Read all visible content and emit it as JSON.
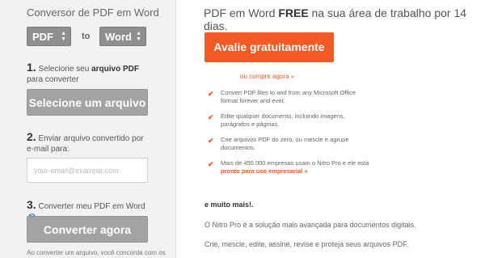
{
  "converter": {
    "title": "Conversor de PDF em Word",
    "from_value": "PDF",
    "to_label": "to",
    "to_value": "Word",
    "step1": {
      "num": "1.",
      "text_a": " Selecione seu ",
      "text_b": "arquivo PDF",
      "text_c": " para converter"
    },
    "select_button": "Selecione um arquivo",
    "step2": {
      "num": "2.",
      "text": " Enviar arquivo convertido por e-mail para:"
    },
    "email_placeholder": "your-email@example.com",
    "step3": {
      "num": "3.",
      "text": " Converter meu PDF em Word",
      "help_icon": "?"
    },
    "convert_button": "Converter agora",
    "footnote": "Ao converter um arquivo, você concorda com os"
  },
  "promo": {
    "headline_a": "PDF em Word ",
    "headline_b": "FREE",
    "headline_c": " na sua área de trabalho por 14 dias.",
    "cta_button": "Avalie gratuitamente",
    "buy_link": "ou compre agora »",
    "features": [
      {
        "text": "Convert PDF files to and from any Microsoft Office format forever and ever."
      },
      {
        "text": "Edite qualquer documento, incluindo imagens, parágrafos e páginas."
      },
      {
        "text": "Crie arquivos PDF do zero, ou mescle e agrupe documentos."
      },
      {
        "text": "Mais de 450.000 empresas usam o Nitro Pro e ele está ",
        "highlight": "pronto para uso empresarial »"
      }
    ],
    "more_heading": "e muito mais!.",
    "paragraph1": "O Nitro Pro é a solução mais avançada para documentos digitais.",
    "paragraph2": "Crie, mescle, edite, assine, revise e proteja seus arquivos PDF."
  },
  "colors": {
    "accent": "#f15a24",
    "gray_button": "#a3a3a3",
    "help": "#2a8ad4"
  }
}
